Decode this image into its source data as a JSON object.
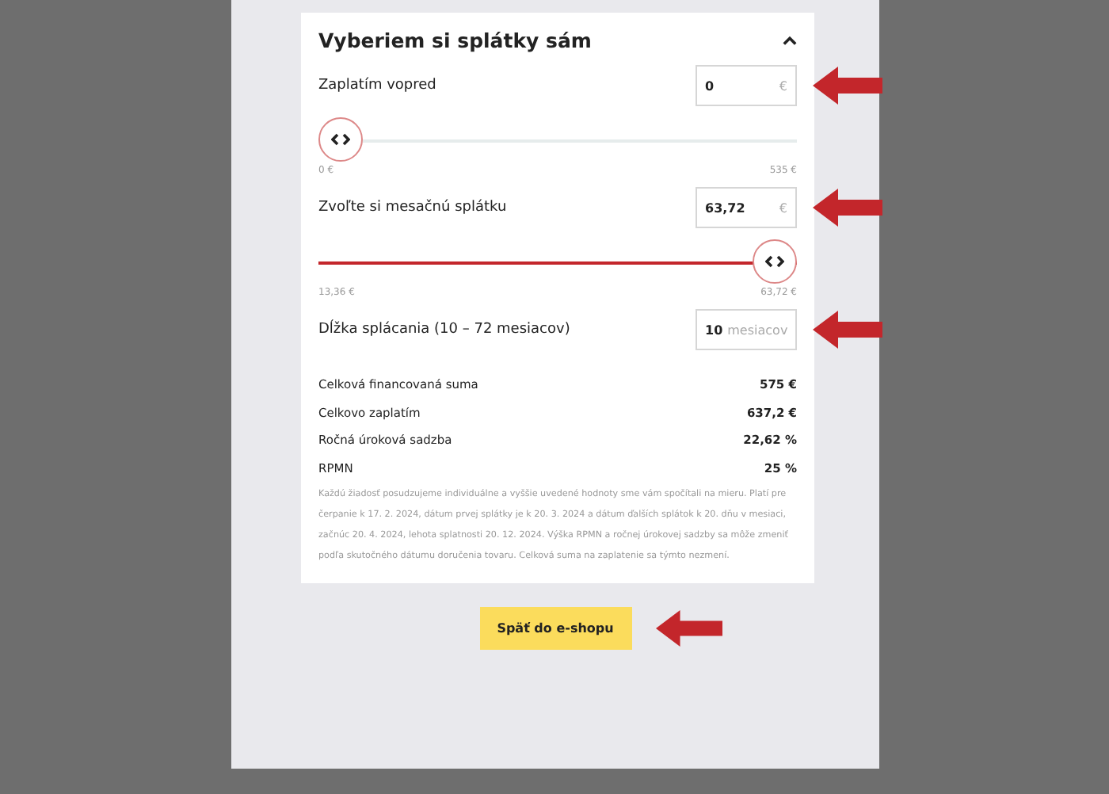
{
  "card": {
    "title": "Vyberiem si splátky sám",
    "expanded": true,
    "fields": [
      {
        "label": "Zaplatím vopred",
        "value": "0",
        "unit": "€",
        "slider": {
          "level": 0,
          "min_label": "0 €",
          "max_label": "535 €"
        }
      },
      {
        "label": "Zvoľte si mesačnú splátku",
        "value": "63,72",
        "unit": "€",
        "slider": {
          "level": 1,
          "min_label": "13,36 €",
          "max_label": "63,72 €"
        }
      },
      {
        "label": "Dĺžka splácania (10 – 72 mesiacov)",
        "value": "10",
        "unit": "mesiacov"
      }
    ],
    "summary": [
      {
        "label": "Celková financovaná suma",
        "value": "575 €"
      },
      {
        "label": "Celkovo zaplatím",
        "value": "637,2 €"
      },
      {
        "label": "Ročná úroková sadzba",
        "value": "22,62 %"
      },
      {
        "label": "RPMN",
        "value": "25 %"
      }
    ],
    "note": "Každú žiadosť posudzujeme individuálne a vyššie uvedené hodnoty sme vám spočítali na mieru. Platí pre čerpanie k 17. 2. 2024, dátum prvej splátky je k 20. 3. 2024 a dátum ďalších splátok k 20. dňu v mesiaci, začnúc 20. 4. 2024, lehota splatnosti 20. 12. 2024. Výška RPMN a ročnej úrokovej sadzby sa môže zmeniť podľa skutočného dátumu doručenia tovaru. Celková suma na zaplatenie sa týmto nezmení."
  },
  "button": {
    "label": "Späť do e-shopu"
  }
}
